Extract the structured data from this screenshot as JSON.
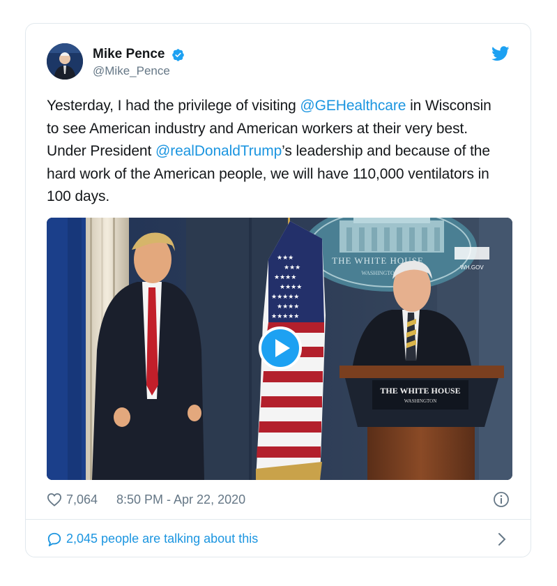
{
  "tweet": {
    "author_name": "Mike Pence",
    "author_handle": "@Mike_Pence",
    "text_parts": {
      "p1": "Yesterday, I had the privilege of visiting ",
      "m1": "@GEHealthcare",
      "p2": " in Wisconsin to see American industry and American workers at their very best. Under President ",
      "m2": "@realDonaldTrump",
      "p3": "’s leadership and because of the hard work of the American people, we will have 110,000 ventilators in 100 days."
    },
    "likes": "7,064",
    "timestamp": "8:50 PM - Apr 22, 2020",
    "talking": "2,045 people are talking about this"
  },
  "media": {
    "seal_text": "THE WHITE HOUSE",
    "seal_sub": "WASHINGTON",
    "podium_text": "THE WHITE HOUSE",
    "podium_sub": "WASHINGTON",
    "watermark": "WH.GOV"
  },
  "icons": {
    "verified": "verified-badge-icon",
    "bird": "twitter-bird-icon",
    "play": "play-icon",
    "heart": "heart-icon",
    "info": "info-icon",
    "reply": "reply-bubble-icon",
    "chevron": "chevron-right-icon"
  },
  "colors": {
    "accent": "#1da1f2",
    "link": "#1b95e0",
    "muted": "#657786"
  }
}
